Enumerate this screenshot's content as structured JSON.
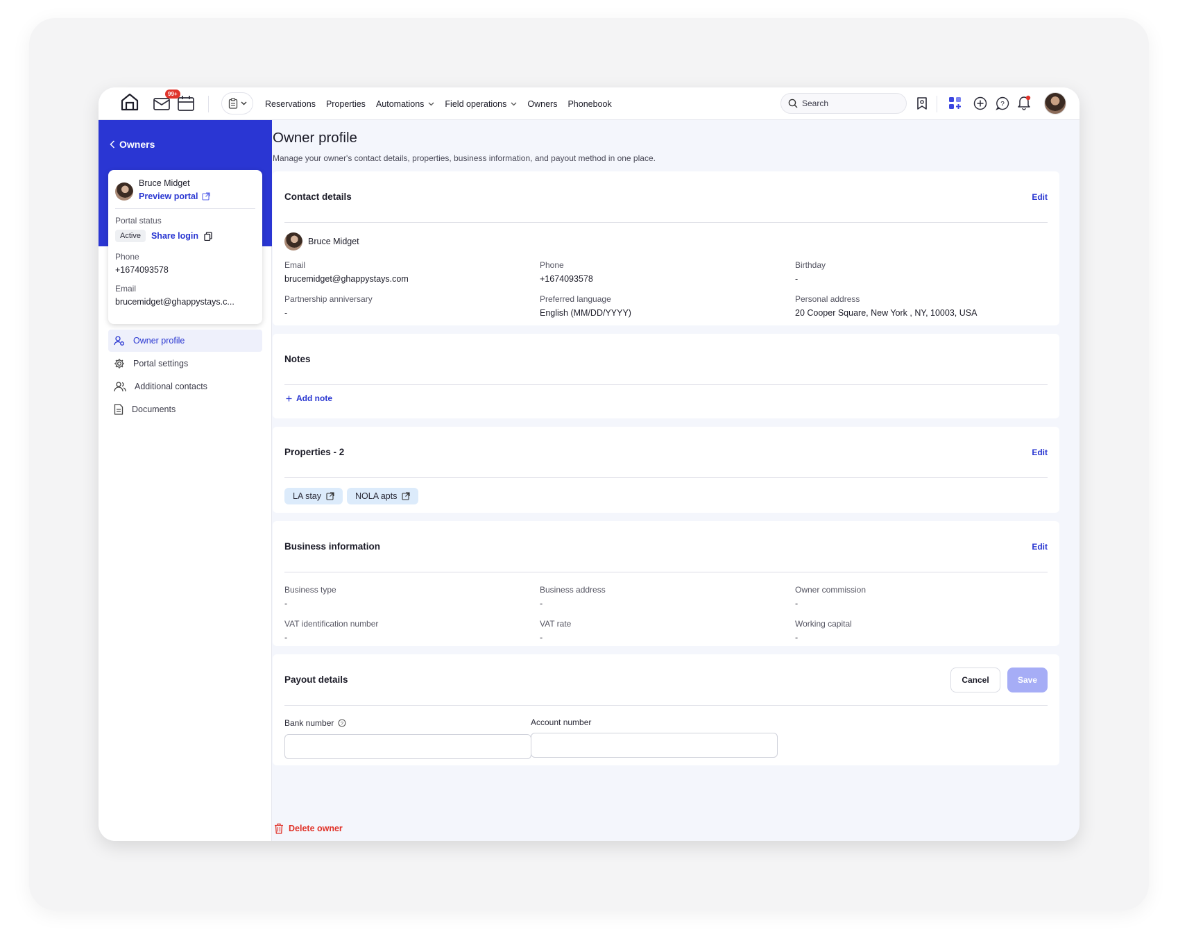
{
  "topbar": {
    "mail_badge": "99+",
    "nav": [
      {
        "label": "Reservations",
        "has_dropdown": false
      },
      {
        "label": "Properties",
        "has_dropdown": false
      },
      {
        "label": "Automations",
        "has_dropdown": true
      },
      {
        "label": "Field operations",
        "has_dropdown": true
      },
      {
        "label": "Owners",
        "has_dropdown": false
      },
      {
        "label": "Phonebook",
        "has_dropdown": false
      }
    ],
    "search_placeholder": "Search"
  },
  "sidebar": {
    "back_label": "Owners",
    "owner": {
      "name": "Bruce Midget",
      "preview_label": "Preview portal",
      "portal_status_label": "Portal status",
      "portal_status": "Active",
      "share_login_label": "Share login",
      "phone_label": "Phone",
      "phone": "+1674093578",
      "email_label": "Email",
      "email": "brucemidget@ghappystays.c..."
    },
    "menu": [
      {
        "label": "Owner profile",
        "icon": "user-settings-icon",
        "active": true
      },
      {
        "label": "Portal settings",
        "icon": "gear-icon",
        "active": false
      },
      {
        "label": "Additional contacts",
        "icon": "users-icon",
        "active": false
      },
      {
        "label": "Documents",
        "icon": "document-icon",
        "active": false
      }
    ]
  },
  "main": {
    "title": "Owner profile",
    "subtitle": "Manage your owner's contact details, properties, business information, and payout method in one place.",
    "edit_label": "Edit",
    "contact": {
      "title": "Contact details",
      "name": "Bruce Midget",
      "email_label": "Email",
      "email": "brucemidget@ghappystays.com",
      "phone_label": "Phone",
      "phone": "+1674093578",
      "birthday_label": "Birthday",
      "birthday": "-",
      "anniversary_label": "Partnership anniversary",
      "anniversary": "-",
      "language_label": "Preferred language",
      "language": "English (MM/DD/YYYY)",
      "address_label": "Personal address",
      "address": "20 Cooper Square, New York , NY, 10003, USA"
    },
    "notes": {
      "title": "Notes",
      "add_label": "Add note"
    },
    "properties": {
      "title": "Properties - 2",
      "items": [
        "LA stay",
        "NOLA apts"
      ]
    },
    "business": {
      "title": "Business information",
      "type_label": "Business type",
      "type": "-",
      "address_label": "Business address",
      "address": "-",
      "commission_label": "Owner commission",
      "commission": "-",
      "vat_id_label": "VAT identification number",
      "vat_id": "-",
      "vat_rate_label": "VAT rate",
      "vat_rate": "-",
      "capital_label": "Working capital",
      "capital": "-"
    },
    "payout": {
      "title": "Payout details",
      "cancel_label": "Cancel",
      "save_label": "Save",
      "bank_label": "Bank number",
      "bank_value": "",
      "account_label": "Account number",
      "account_value": ""
    },
    "delete_label": "Delete owner"
  },
  "colors": {
    "accent": "#2936d1",
    "sidebar_band": "#2a36d3",
    "danger": "#e03228",
    "save_disabled": "#a6adf6",
    "chip_bg": "#dcebfb"
  }
}
